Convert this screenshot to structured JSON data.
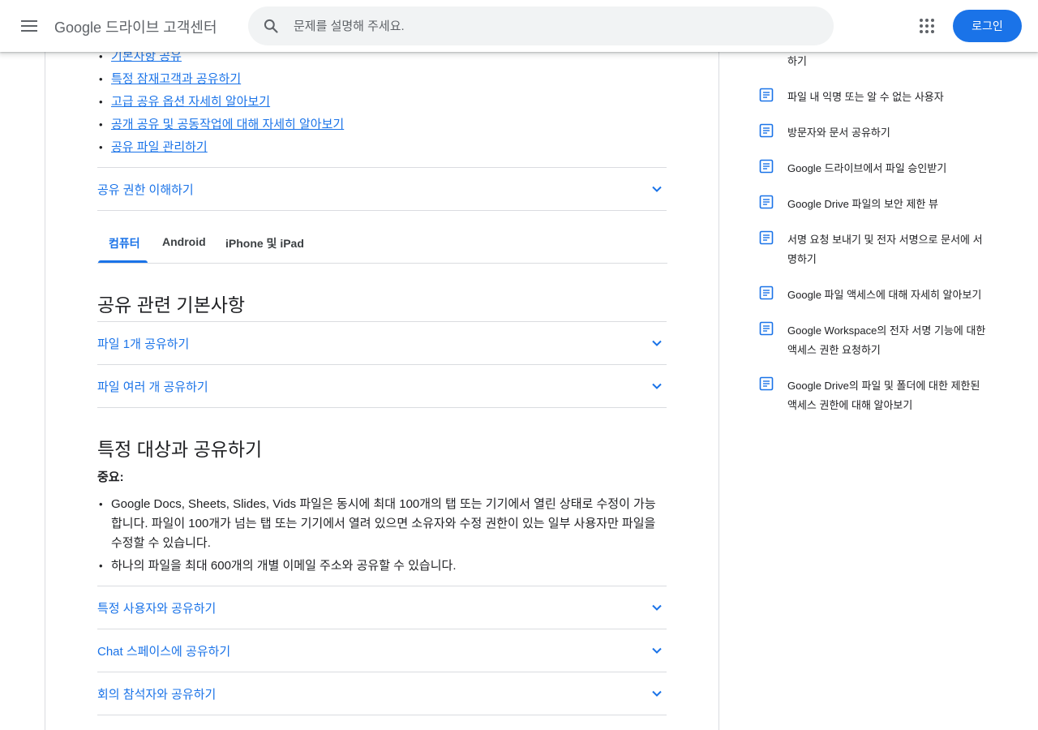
{
  "header": {
    "brand": "Google 드라이브 고객센터",
    "search_placeholder": "문제를 설명해 주세요.",
    "login_label": "로그인"
  },
  "article": {
    "top_links": [
      "기본사항 공유",
      "특정 잠재고객과 공유하기",
      "고급 공유 옵션 자세히 알아보기",
      "공개 공유 및 공동작업에 대해 자세히 알아보기",
      "공유 파일 관리하기"
    ],
    "permissions_accordion": "공유 권한 이해하기",
    "tabs": [
      "컴퓨터",
      "Android",
      "iPhone 및 iPad"
    ],
    "section1": {
      "title": "공유 관련 기본사항",
      "items": [
        "파일 1개 공유하기",
        "파일 여러 개 공유하기"
      ]
    },
    "section2": {
      "title": "특정 대상과 공유하기",
      "important_label": "중요:",
      "bullets": [
        "Google Docs, Sheets, Slides, Vids 파일은 동시에 최대 100개의 탭 또는 기기에서 열린 상태로 수정이 가능합니다. 파일이 100개가 넘는 탭 또는 기기에서 열려 있으면 소유자와 수정 권한이 있는 일부 사용자만 파일을 수정할 수 있습니다.",
        "하나의 파일을 최대 600개의 개별 이메일 주소와 공유할 수 있습니다."
      ],
      "items": [
        "특정 사용자와 공유하기",
        "Chat 스페이스에 공유하기",
        "회의 참석자와 공유하기"
      ]
    }
  },
  "sidebar": {
    "partial_item_tail": "하기",
    "items": [
      "파일 내 익명 또는 알 수 없는 사용자",
      "방문자와 문서 공유하기",
      "Google 드라이브에서 파일 승인받기",
      "Google Drive 파일의 보안 제한 뷰",
      "서명 요청 보내기 및 전자 서명으로 문서에 서명하기",
      "Google 파일 액세스에 대해 자세히 알아보기",
      "Google Workspace의 전자 서명 기능에 대한 액세스 권한 요청하기",
      "Google Drive의 파일 및 폴더에 대한 제한된 액세스 권한에 대해 알아보기"
    ]
  },
  "colors": {
    "accent": "#1a73e8",
    "text": "#202124",
    "secondary": "#5f6368",
    "divider": "#dadce0"
  },
  "icons": [
    "menu-icon",
    "search-icon",
    "apps-icon",
    "chevron-down-icon",
    "document-icon"
  ]
}
